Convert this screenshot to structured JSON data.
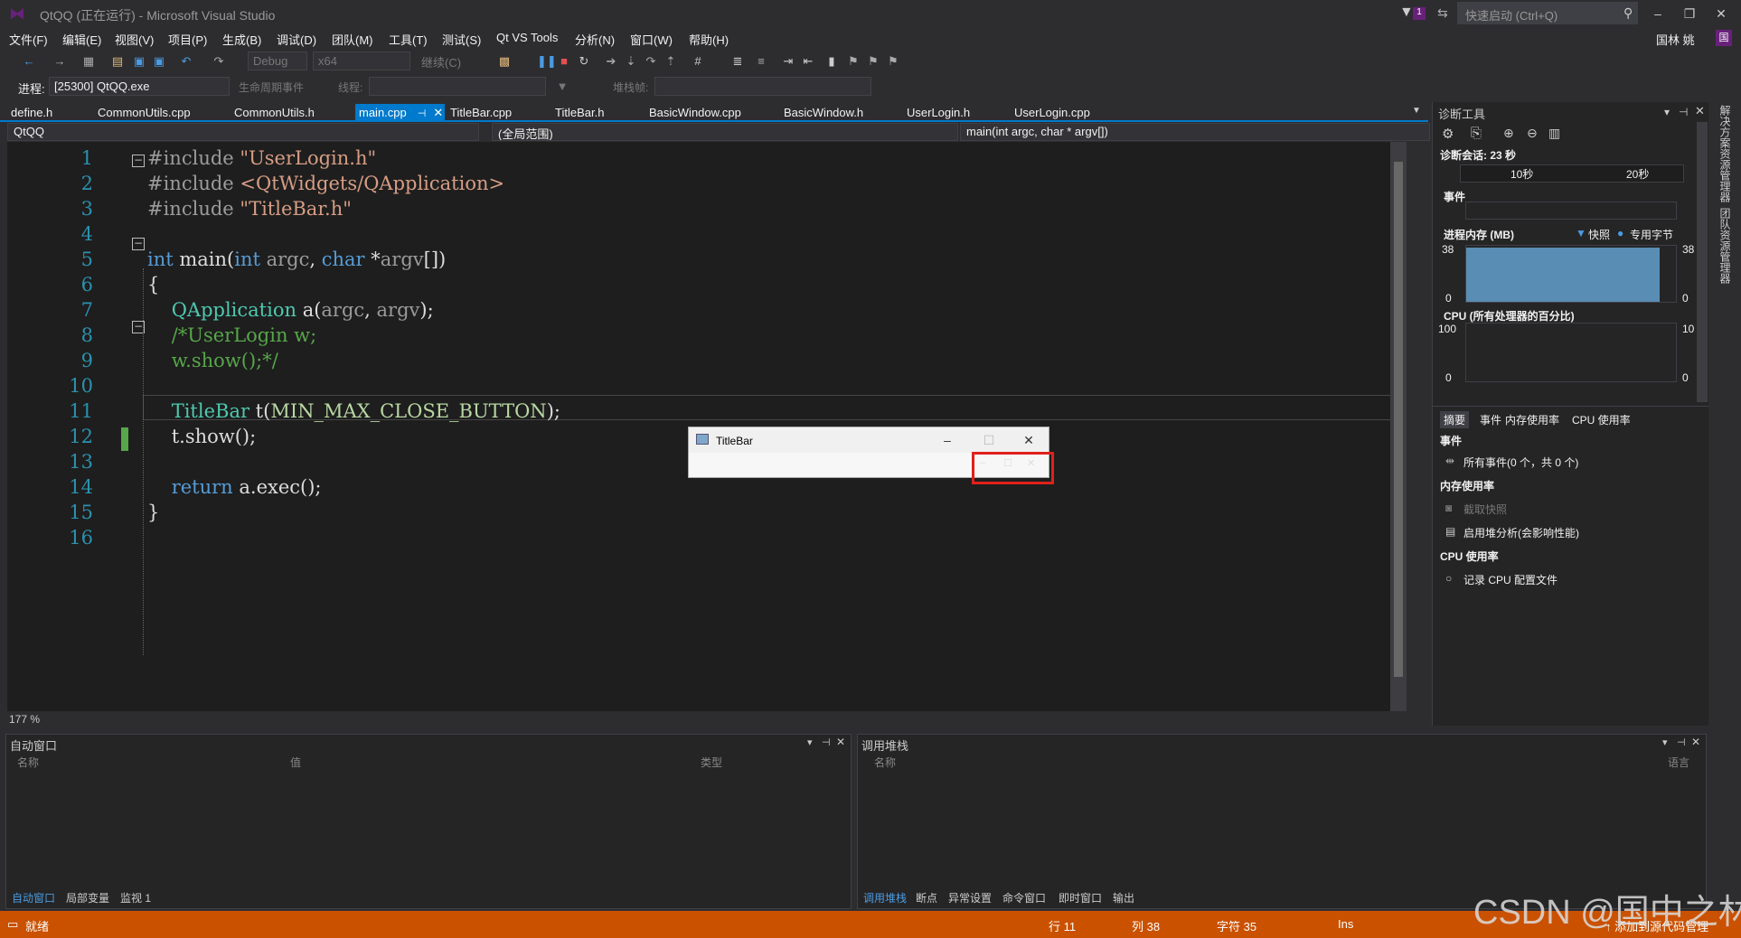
{
  "window": {
    "title": "QtQQ (正在运行) - Microsoft Visual Studio",
    "quick_launch": "快速启动 (Ctrl+Q)",
    "user": "国林 姚",
    "notify_count": "1"
  },
  "menu": [
    "文件(F)",
    "编辑(E)",
    "视图(V)",
    "项目(P)",
    "生成(B)",
    "调试(D)",
    "团队(M)",
    "工具(T)",
    "测试(S)",
    "Qt VS Tools",
    "分析(N)",
    "窗口(W)",
    "帮助(H)"
  ],
  "toolbar": {
    "config": "Debug",
    "platform": "x64",
    "continue": "继续(C)"
  },
  "process_bar": {
    "process_label": "进程:",
    "process_value": "[25300] QtQQ.exe",
    "lifecycle": "生命周期事件",
    "thread_label": "线程:",
    "stack_label": "堆栈帧:"
  },
  "tabs": [
    "define.h",
    "CommonUtils.cpp",
    "CommonUtils.h",
    "main.cpp",
    "TitleBar.cpp",
    "TitleBar.h",
    "BasicWindow.cpp",
    "BasicWindow.h",
    "UserLogin.h",
    "UserLogin.cpp"
  ],
  "nav": {
    "project": "QtQQ",
    "scope": "(全局范围)",
    "member": "main(int argc, char * argv[])"
  },
  "code_lines": [
    {
      "n": "1",
      "text": "#include \"UserLogin.h\""
    },
    {
      "n": "2",
      "text": "#include <QtWidgets/QApplication>"
    },
    {
      "n": "3",
      "text": "#include \"TitleBar.h\""
    },
    {
      "n": "4",
      "text": ""
    },
    {
      "n": "5",
      "text": "int main(int argc, char *argv[])"
    },
    {
      "n": "6",
      "text": "{"
    },
    {
      "n": "7",
      "text": "    QApplication a(argc, argv);"
    },
    {
      "n": "8",
      "text": "    /*UserLogin w;"
    },
    {
      "n": "9",
      "text": "    w.show();*/"
    },
    {
      "n": "10",
      "text": ""
    },
    {
      "n": "11",
      "text": "    TitleBar t(MIN_MAX_CLOSE_BUTTON);"
    },
    {
      "n": "12",
      "text": "    t.show();"
    },
    {
      "n": "13",
      "text": ""
    },
    {
      "n": "14",
      "text": "    return a.exec();"
    },
    {
      "n": "15",
      "text": "}"
    },
    {
      "n": "16",
      "text": ""
    }
  ],
  "zoom": "177 %",
  "diag": {
    "title": "诊断工具",
    "session": "诊断会话: 23 秒",
    "t10": "10秒",
    "t20": "20秒",
    "events": "事件",
    "mem_title": "进程内存 (MB)",
    "snapshot": "快照",
    "private_bytes": "专用字节",
    "mem_max": "38",
    "mem_min": "0",
    "mem_max_r": "38",
    "mem_min_r": "0",
    "cpu_title": "CPU (所有处理器的百分比)",
    "cpu_max": "100",
    "cpu_min": "0",
    "cpu_max_r": "10",
    "cpu_min_r": "0",
    "tabs": [
      "摘要",
      "事件",
      "内存使用率",
      "CPU 使用率"
    ],
    "sec_events": "事件",
    "all_events": "所有事件(0 个，共 0 个)",
    "sec_mem": "内存使用率",
    "take_snapshot": "截取快照",
    "heap": "启用堆分析(会影响性能)",
    "sec_cpu": "CPU 使用率",
    "record_cpu": "记录 CPU 配置文件"
  },
  "side_tabs": [
    "解决方案资源管理器",
    "团队资源管理器"
  ],
  "autos": {
    "title": "自动窗口",
    "col_name": "名称",
    "col_value": "值",
    "col_type": "类型",
    "tabs": [
      "自动窗口",
      "局部变量",
      "监视 1"
    ]
  },
  "callstack": {
    "title": "调用堆栈",
    "col_name": "名称",
    "col_lang": "语言",
    "tabs": [
      "调用堆栈",
      "断点",
      "异常设置",
      "命令窗口",
      "即时窗口",
      "输出"
    ]
  },
  "status": {
    "ready": "就绪",
    "row": "行 11",
    "col": "列 38",
    "ch": "字符 35",
    "ins": "Ins",
    "source": "添加到源代码管理"
  },
  "popup": {
    "title": "TitleBar"
  },
  "watermark": "CSDN @国中之林"
}
